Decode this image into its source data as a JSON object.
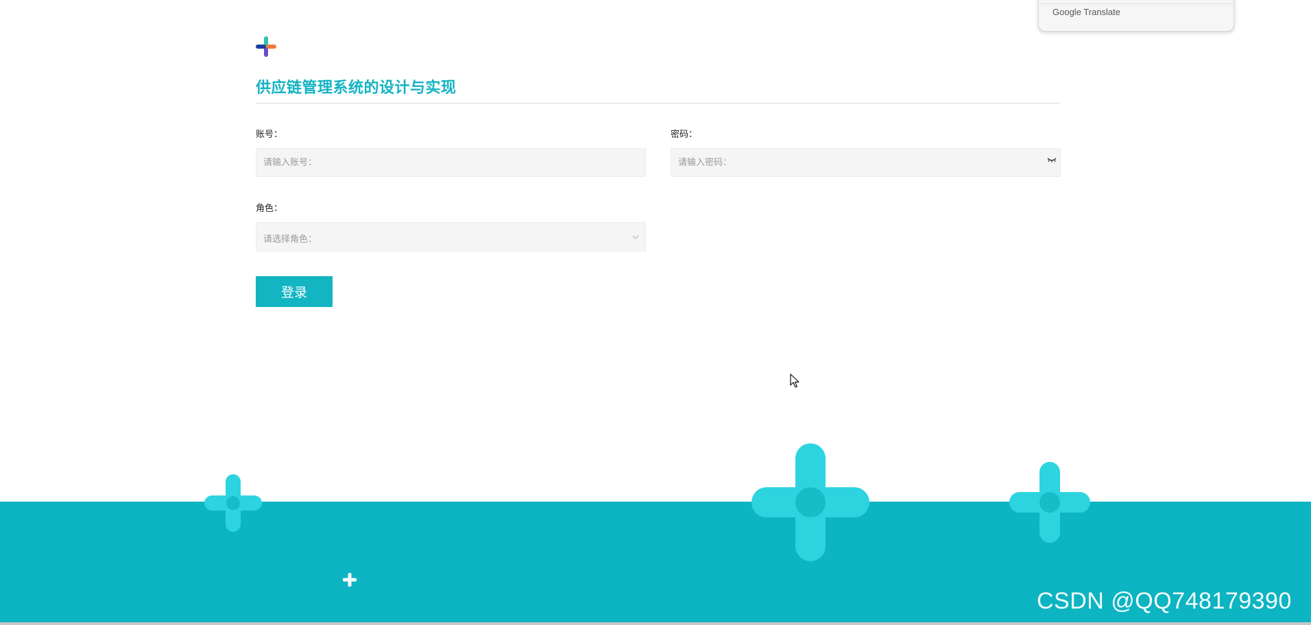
{
  "translate_popup": {
    "label": "Google Translate"
  },
  "page": {
    "title": "供应链管理系统的设计与实现"
  },
  "form": {
    "account": {
      "label": "账号：",
      "placeholder": "请输入账号：",
      "value": ""
    },
    "password": {
      "label": "密码：",
      "placeholder": "请输入密码：",
      "value": ""
    },
    "role": {
      "label": "角色：",
      "placeholder": "请选择角色："
    },
    "submit_label": "登录"
  },
  "icons": {
    "logo": "plus-logo-icon",
    "password_toggle": "eye-closed-icon",
    "role_dropdown": "chevron-down-icon",
    "cursor": "mouse-pointer-icon"
  },
  "colors": {
    "accent": "#12b3c3",
    "button": "#13b5c2",
    "footer": "#0db4c2",
    "decoration": "#2dd4e0"
  },
  "watermark": "CSDN @QQ748179390"
}
